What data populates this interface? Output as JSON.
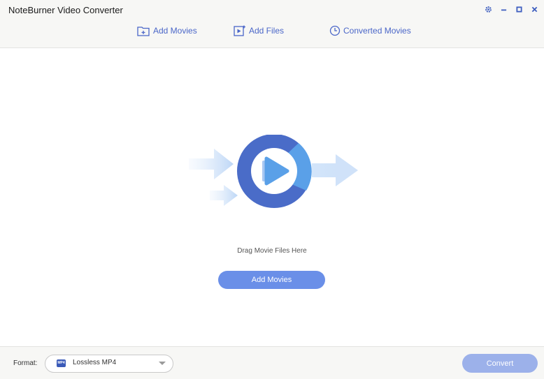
{
  "app": {
    "title": "NoteBurner Video Converter"
  },
  "window_controls": {
    "settings_icon": "gear-icon",
    "minimize_icon": "minimize-icon",
    "maximize_icon": "maximize-icon",
    "close_icon": "close-icon"
  },
  "toolbar": {
    "add_movies": "Add Movies",
    "add_files": "Add Files",
    "converted_movies": "Converted Movies"
  },
  "main": {
    "drag_hint": "Drag Movie Files Here",
    "add_movies_button": "Add Movies"
  },
  "footer": {
    "format_label": "Format:",
    "format_value": "Lossless MP4",
    "format_icon_text": "MP4",
    "convert_button": "Convert"
  },
  "colors": {
    "accent": "#4a66c8",
    "button": "#6a8fe8",
    "button_disabled": "#9cb1ea",
    "disc_dark": "#4a6cc8",
    "disc_light": "#5aa0e8"
  }
}
